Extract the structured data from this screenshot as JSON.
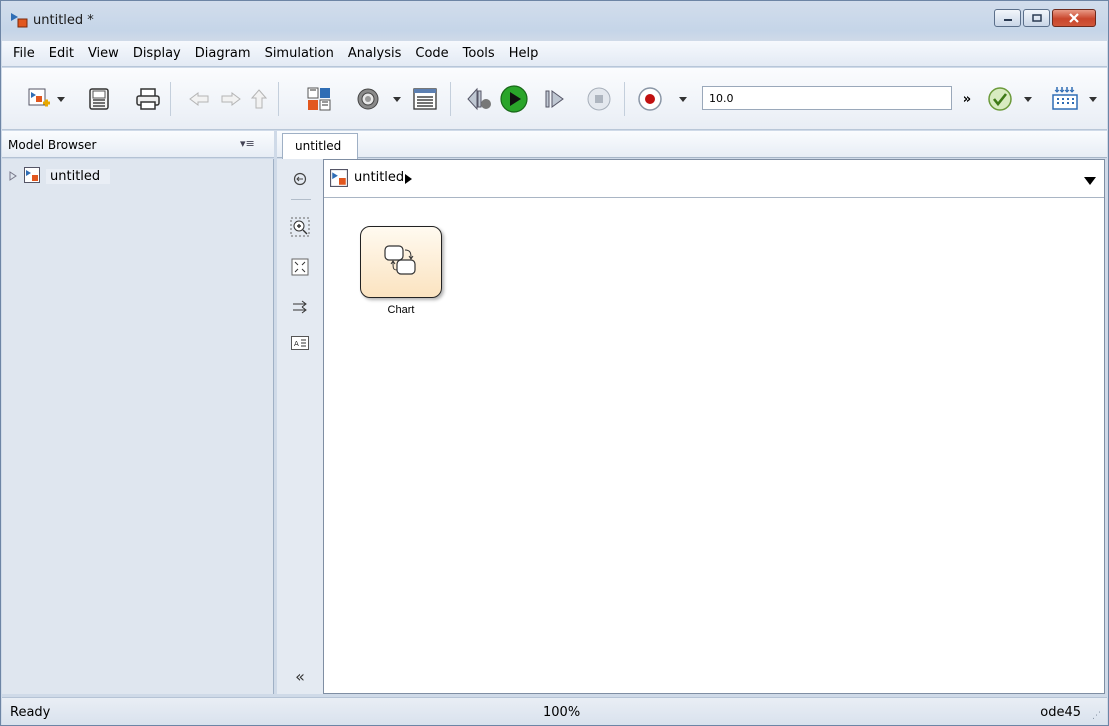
{
  "window": {
    "title": "untitled *"
  },
  "menu": [
    "File",
    "Edit",
    "View",
    "Display",
    "Diagram",
    "Simulation",
    "Analysis",
    "Code",
    "Tools",
    "Help"
  ],
  "toolbar": {
    "stop_time": "10.0",
    "more_label": "»",
    "icons": [
      "new-model-icon",
      "save-icon",
      "print-icon",
      "back-icon",
      "forward-icon",
      "up-icon",
      "library-browser-icon",
      "model-config-icon",
      "model-explorer-icon",
      "step-back-icon",
      "run-icon",
      "step-forward-icon",
      "stop-icon",
      "record-icon",
      "check-icon",
      "hardware-icon"
    ]
  },
  "model_browser": {
    "title": "Model Browser",
    "menu_glyph": "▾≡",
    "tree": [
      {
        "label": "untitled",
        "expanded": false
      }
    ]
  },
  "tabs": [
    {
      "label": "untitled",
      "active": true
    }
  ],
  "address_bar": {
    "path": "untitled",
    "arrow": "▶",
    "dropdown": "▼"
  },
  "canvas": {
    "blocks": [
      {
        "label": "Chart",
        "type": "stateflow-chart"
      }
    ]
  },
  "palette": {
    "collapse_glyph": "«"
  },
  "status": {
    "state": "Ready",
    "zoom": "100%",
    "solver": "ode45"
  },
  "colors": {
    "accent_blue": "#2f6db5",
    "run_green": "#2aa52a",
    "record_red": "#c01010",
    "chart_fill": "#fbe3c0"
  }
}
